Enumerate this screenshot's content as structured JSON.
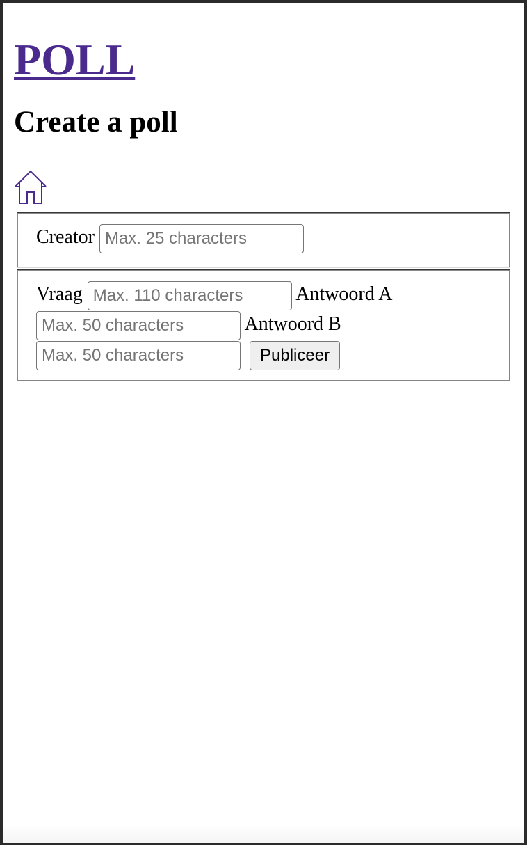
{
  "header": {
    "site_title": "POLL",
    "page_title": "Create a poll"
  },
  "nav": {
    "home_icon": "home-icon"
  },
  "creator": {
    "label": "Creator",
    "placeholder": "Max. 25 characters",
    "value": ""
  },
  "question": {
    "label": "Vraag",
    "placeholder": "Max. 110 characters",
    "value": ""
  },
  "answer_a": {
    "label": "Antwoord A",
    "placeholder": "Max. 50 characters",
    "value": ""
  },
  "answer_b": {
    "label": "Antwoord B",
    "placeholder": "Max. 50 characters",
    "value": ""
  },
  "publish_button": {
    "label": "Publiceer"
  },
  "colors": {
    "link": "#4b2a8e",
    "text": "#000000",
    "background": "#ffffff",
    "window_border": "#2b2b2b"
  }
}
